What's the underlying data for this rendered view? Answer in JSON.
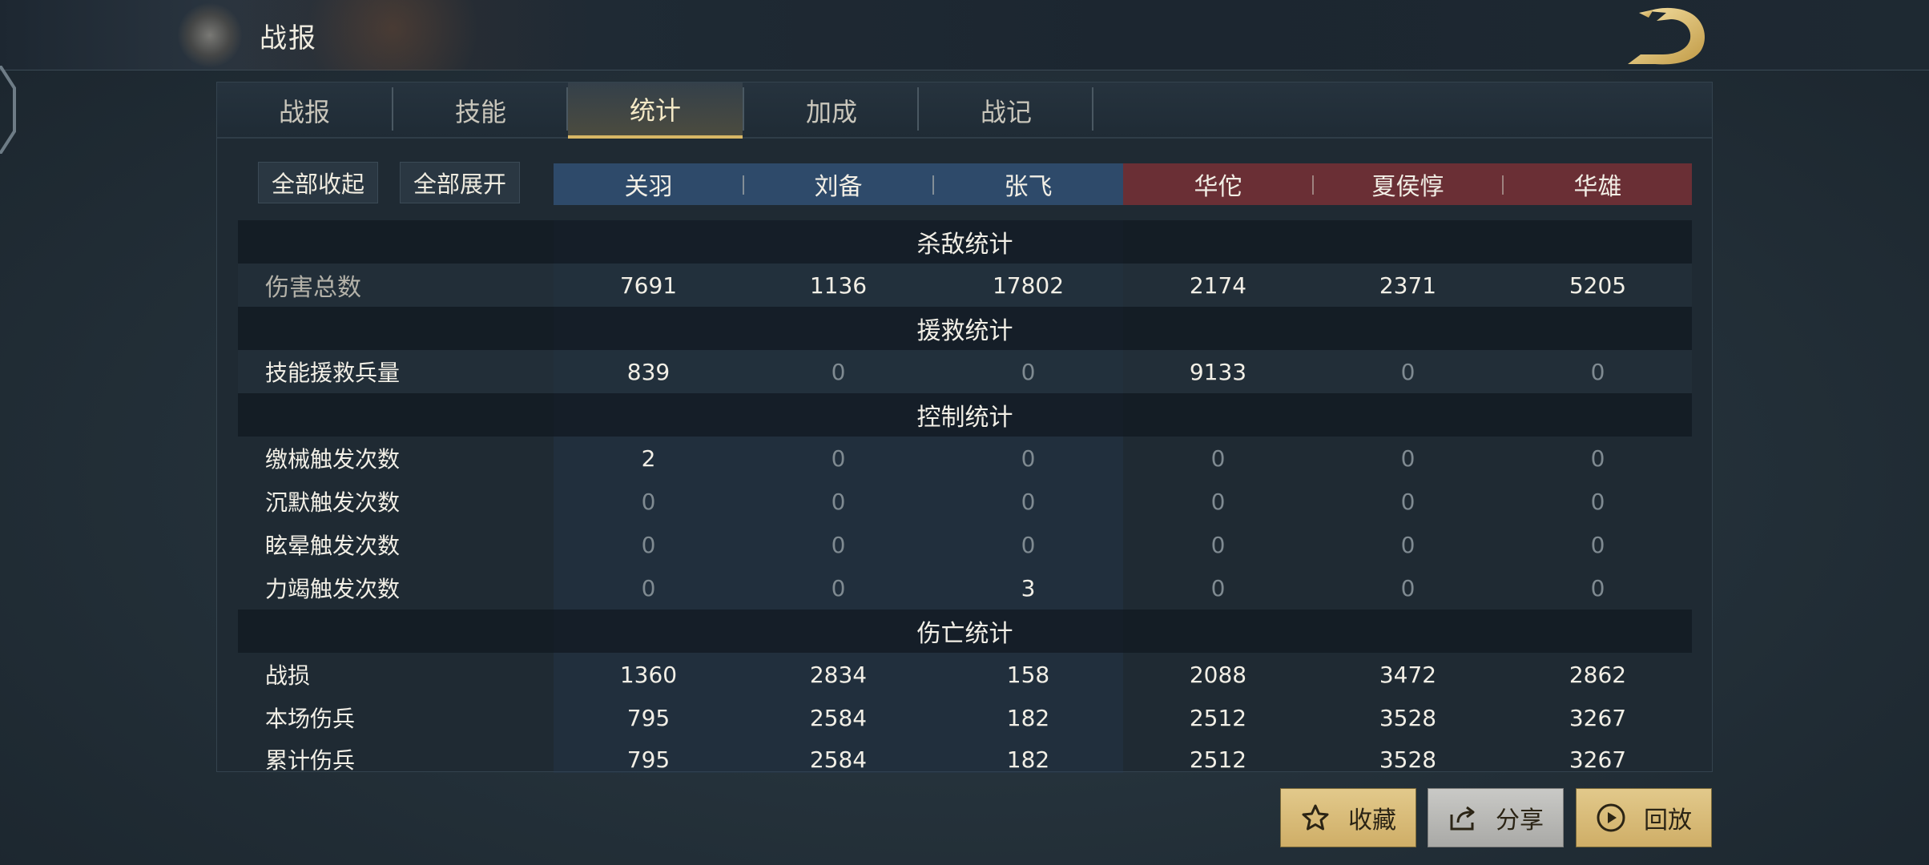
{
  "page": {
    "title": "战报"
  },
  "tabs": [
    {
      "label": "战报",
      "active": false
    },
    {
      "label": "技能",
      "active": false
    },
    {
      "label": "统计",
      "active": true
    },
    {
      "label": "加成",
      "active": false
    },
    {
      "label": "战记",
      "active": false
    }
  ],
  "controls": {
    "collapse_all": "全部收起",
    "expand_all": "全部展开"
  },
  "team_colors": {
    "ally": "#2e4a6a",
    "enemy": "#6a2f35",
    "accent": "#d9b765"
  },
  "generals": [
    {
      "name": "关羽",
      "team": "ally"
    },
    {
      "name": "刘备",
      "team": "ally"
    },
    {
      "name": "张飞",
      "team": "ally"
    },
    {
      "name": "华佗",
      "team": "enemy"
    },
    {
      "name": "夏侯惇",
      "team": "enemy"
    },
    {
      "name": "华雄",
      "team": "enemy"
    }
  ],
  "sections": [
    {
      "title": "杀敌统计",
      "rows": [
        {
          "label": "伤害总数",
          "values": [
            "7691",
            "1136",
            "17802",
            "2174",
            "2371",
            "5205"
          ]
        }
      ]
    },
    {
      "title": "援救统计",
      "rows": [
        {
          "label": "技能援救兵量",
          "values": [
            "839",
            "0",
            "0",
            "9133",
            "0",
            "0"
          ]
        }
      ]
    },
    {
      "title": "控制统计",
      "rows": [
        {
          "label": "缴械触发次数",
          "values": [
            "2",
            "0",
            "0",
            "0",
            "0",
            "0"
          ]
        },
        {
          "label": "沉默触发次数",
          "values": [
            "0",
            "0",
            "0",
            "0",
            "0",
            "0"
          ]
        },
        {
          "label": "眩晕触发次数",
          "values": [
            "0",
            "0",
            "0",
            "0",
            "0",
            "0"
          ]
        },
        {
          "label": "力竭触发次数",
          "values": [
            "0",
            "0",
            "3",
            "0",
            "0",
            "0"
          ]
        }
      ]
    },
    {
      "title": "伤亡统计",
      "rows": [
        {
          "label": "战损",
          "values": [
            "1360",
            "2834",
            "158",
            "2088",
            "3472",
            "2862"
          ]
        },
        {
          "label": "本场伤兵",
          "values": [
            "795",
            "2584",
            "182",
            "2512",
            "3528",
            "3267"
          ]
        },
        {
          "label": "累计伤兵",
          "values": [
            "795",
            "2584",
            "182",
            "2512",
            "3528",
            "3267"
          ]
        }
      ]
    }
  ],
  "actions": {
    "favorite": {
      "label": "收藏",
      "icon": "star-icon"
    },
    "share": {
      "label": "分享",
      "icon": "share-icon"
    },
    "replay": {
      "label": "回放",
      "icon": "play-icon"
    }
  }
}
